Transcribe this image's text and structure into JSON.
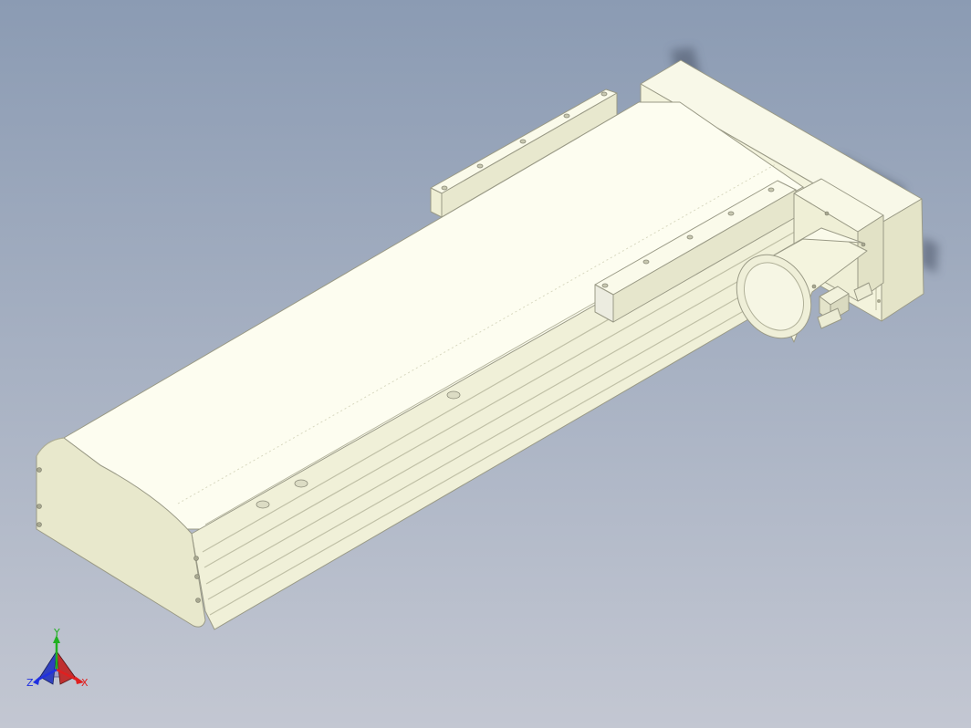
{
  "viewport": {
    "background_top": "#8b9bb3",
    "background_bottom": "#c3c7d2",
    "model_color": "#f6f6e2",
    "model_shade": "#e6e6cc",
    "model_dark": "#d6d6bc",
    "edge_color": "#9a9a86",
    "shadow_color": "#5a6478"
  },
  "model": {
    "icons": {
      "actuator": "linear-actuator-icon",
      "motor": "servo-motor-icon",
      "bracket": "mounting-bracket-icon"
    }
  },
  "triad": {
    "x_label": "X",
    "y_label": "Y",
    "z_label": "Z",
    "x_color": "#e02020",
    "y_color": "#20b020",
    "z_color": "#2030e0",
    "icon": "coordinate-triad-icon"
  }
}
